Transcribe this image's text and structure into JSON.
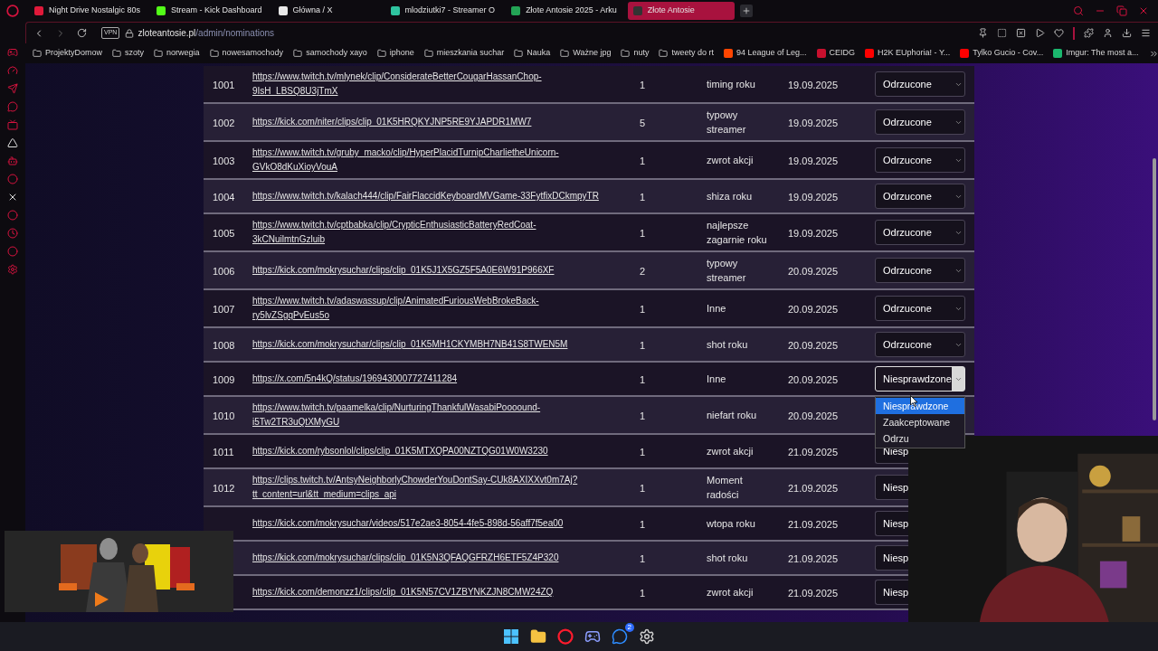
{
  "browser": {
    "tabs": [
      {
        "title": "Night Drive Nostalgic 80s",
        "color": "#e0193a",
        "selected": false
      },
      {
        "title": "Stream - Kick Dashboard",
        "color": "#53fc18",
        "selected": false
      },
      {
        "title": "Główna / X",
        "color": "#e8e8e8",
        "selected": false
      },
      {
        "title": "mlodziutki7 - Streamer O",
        "color": "#2fc4a0",
        "selected": false
      },
      {
        "title": "Złote Antosie 2025 - Arku",
        "color": "#23a455",
        "selected": false
      },
      {
        "title": "Złote Antosie",
        "color": "#333333",
        "selected": true
      }
    ],
    "vpn": "VPN",
    "url_host": "zloteantosie.pl",
    "url_path": "/admin/nominations",
    "bookmarks": [
      {
        "kind": "folder",
        "label": "ProjektyDomow"
      },
      {
        "kind": "folder",
        "label": "szoty"
      },
      {
        "kind": "folder",
        "label": "norwegia"
      },
      {
        "kind": "folder",
        "label": "nowesamochody"
      },
      {
        "kind": "folder",
        "label": "samochody xayo"
      },
      {
        "kind": "folder",
        "label": "iphone"
      },
      {
        "kind": "folder",
        "label": "mieszkania suchar"
      },
      {
        "kind": "folder",
        "label": "Nauka"
      },
      {
        "kind": "folder",
        "label": "Ważne jpg"
      },
      {
        "kind": "folder",
        "label": "nuty"
      },
      {
        "kind": "folder",
        "label": "tweety do rt"
      },
      {
        "kind": "site",
        "label": "94 League of Leg...",
        "color": "#ff4500"
      },
      {
        "kind": "site",
        "label": "CEIDG",
        "color": "#c8102e"
      },
      {
        "kind": "site",
        "label": "H2K EUphoria! - Y...",
        "color": "#ff0000"
      },
      {
        "kind": "site",
        "label": "Tylko Gucio - Cov...",
        "color": "#ff0000"
      },
      {
        "kind": "site",
        "label": "Imgur: The most a...",
        "color": "#1bb76e"
      }
    ]
  },
  "table": {
    "rows": [
      {
        "id": "1001",
        "url": "https://www.twitch.tv/mlynek/clip/ConsiderateBetterCougarHassanChop-9IsH_LBSQ8U3jTmX",
        "count": "1",
        "category": "timing roku",
        "date": "19.09.2025",
        "status": "Odrzucone"
      },
      {
        "id": "1002",
        "url": "https://kick.com/niter/clips/clip_01K5HRQKYJNP5RE9YJAPDR1MW7",
        "count": "5",
        "category": "typowy streamer",
        "date": "19.09.2025",
        "status": "Odrzucone"
      },
      {
        "id": "1003",
        "url": "https://www.twitch.tv/gruby_macko/clip/HyperPlacidTurnipCharlietheUnicorn-GVkO8dKuXioyVouA",
        "count": "1",
        "category": "zwrot akcji",
        "date": "19.09.2025",
        "status": "Odrzucone"
      },
      {
        "id": "1004",
        "url": "https://www.twitch.tv/kalach444/clip/FairFlaccidKeyboardMVGame-33FytfixDCkmpyTR",
        "count": "1",
        "category": "shiza roku",
        "date": "19.09.2025",
        "status": "Odrzucone"
      },
      {
        "id": "1005",
        "url": "https://www.twitch.tv/cptbabka/clip/CrypticEnthusiasticBatteryRedCoat-3kCNuilmtnGzluib",
        "count": "1",
        "category": "najlepsze zagarnie roku",
        "date": "19.09.2025",
        "status": "Odrzucone"
      },
      {
        "id": "1006",
        "url": "https://kick.com/mokrysuchar/clips/clip_01K5J1X5GZ5F5A0E6W91P966XF",
        "count": "2",
        "category": "typowy streamer",
        "date": "20.09.2025",
        "status": "Odrzucone"
      },
      {
        "id": "1007",
        "url": "https://www.twitch.tv/adaswassup/clip/AnimatedFuriousWebBrokeBack-ry5lvZSgqPvEus5o",
        "count": "1",
        "category": "Inne",
        "date": "20.09.2025",
        "status": "Odrzucone"
      },
      {
        "id": "1008",
        "url": "https://kick.com/mokrysuchar/clips/clip_01K5MH1CKYMBH7NB41S8TWEN5M",
        "count": "1",
        "category": "shot roku",
        "date": "20.09.2025",
        "status": "Odrzucone"
      },
      {
        "id": "1009",
        "url": "https://x.com/5n4kQ/status/1969430007727411284",
        "count": "1",
        "category": "Inne",
        "date": "20.09.2025",
        "status": "Niesprawdzone",
        "dropdown": [
          {
            "label": "Niesprawdzone",
            "selected": true
          },
          {
            "label": "Zaakceptowane",
            "selected": false
          },
          {
            "label": "Odrzu",
            "selected": false
          }
        ]
      },
      {
        "id": "1010",
        "url": "https://www.twitch.tv/paamelka/clip/NurturingThankfulWasabiPoooound-i5Tw2TR3uQtXMyGU",
        "count": "1",
        "category": "niefart roku",
        "date": "20.09.2025"
      },
      {
        "id": "1011",
        "url": "https://kick.com/rybsonlol/clips/clip_01K5MTXQPA00NZTQG01W0W3230",
        "count": "1",
        "category": "zwrot akcji",
        "date": "21.09.2025",
        "status": "Niesp",
        "cut": true
      },
      {
        "id": "1012",
        "url": "https://clips.twitch.tv/AntsyNeighborlyChowderYouDontSay-CUk8AXIXXvt0m7Aj?tt_content=url&tt_medium=clips_api",
        "count": "1",
        "category": "Moment radości",
        "date": "21.09.2025",
        "status": "Niesp",
        "cut": true
      },
      {
        "url": "https://kick.com/mokrysuchar/videos/517e2ae3-8054-4fe5-898d-56aff7f5ea00",
        "count": "1",
        "category": "wtopa roku",
        "date": "21.09.2025",
        "status": "Niesp",
        "cut": true
      },
      {
        "url": "https://kick.com/mokrysuchar/clips/clip_01K5N3QFAQGFRZH6ETF5Z4P320",
        "count": "1",
        "category": "shot roku",
        "date": "21.09.2025",
        "status": "Niesp",
        "cut": true
      },
      {
        "url": "https://kick.com/demonzz1/clips/clip_01K5N57CV1ZBYNKZJN8CMW24ZQ",
        "count": "1",
        "category": "zwrot akcji",
        "date": "21.09.2025",
        "status": "Niesp",
        "cut": true
      }
    ]
  },
  "taskbar": [
    {
      "kind": "start"
    },
    {
      "kind": "folder"
    },
    {
      "kind": "browser"
    },
    {
      "kind": "chat"
    },
    {
      "kind": "messenger",
      "badge": "2"
    },
    {
      "kind": "steam"
    }
  ]
}
